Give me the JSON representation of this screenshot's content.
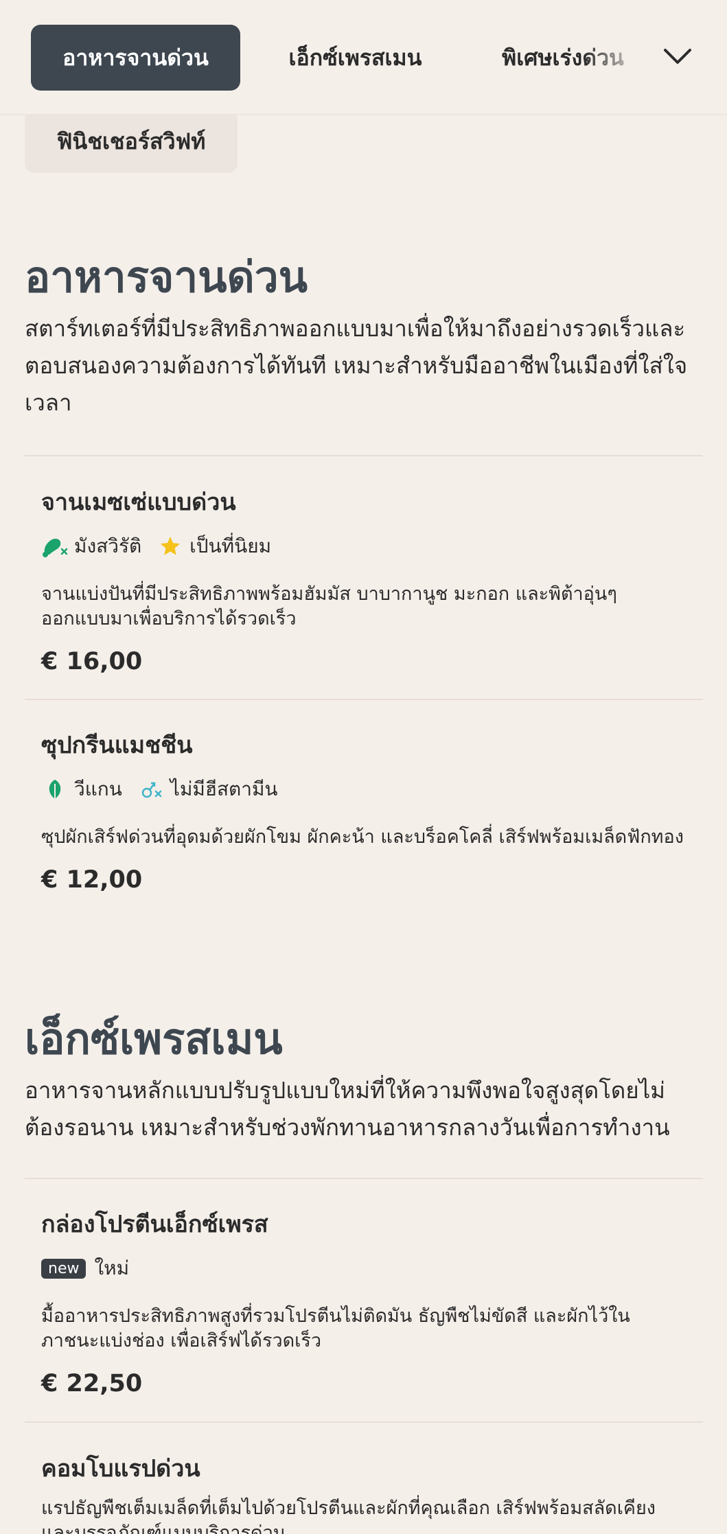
{
  "tabs": [
    {
      "label": "อาหารจานด่วน",
      "active": true
    },
    {
      "label": "เอ็กซ์เพรสเมน",
      "active": false
    },
    {
      "label": "พิเศษเร่งด่วน",
      "active": false
    }
  ],
  "more_tabs_icon": "chevron-down-icon",
  "category_pill": "ฟินิชเชอร์สวิฟท์",
  "sections": [
    {
      "title": "อาหารจานด่วน",
      "description": "สตาร์ทเตอร์ที่มีประสิทธิภาพออกแบบมาเพื่อให้มาถึงอย่างรวดเร็วและตอบสนองความต้องการได้ทันที เหมาะสำหรับมืออาชีพในเมืองที่ใส่ใจเวลา",
      "items": [
        {
          "name": "จานเมซเซ่แบบด่วน",
          "tags": [
            {
              "icon": "meat-free-icon",
              "label": "มังสวิรัติ",
              "color": "#1aa36b"
            },
            {
              "icon": "star-icon",
              "label": "เป็นที่นิยม",
              "color": "#f4c21b"
            }
          ],
          "description": "จานแบ่งปันที่มีประสิทธิภาพพร้อมฮัมมัส บาบากานูช มะกอก และพิต้าอุ่นๆ ออกแบบมาเพื่อบริการได้รวดเร็ว",
          "price": "€ 16,00"
        },
        {
          "name": "ซุปกรีนแมชชีน",
          "tags": [
            {
              "icon": "leaf-icon",
              "label": "วีแกน",
              "color": "#1aa36b"
            },
            {
              "icon": "no-histamine-icon",
              "label": "ไม่มีฮีสตามีน",
              "color": "#3fb6c9"
            }
          ],
          "description": "ซุปผักเสิร์ฟด่วนที่อุดมด้วยผักโขม ผักคะน้า และบร็อคโคลี่ เสิร์ฟพร้อมเมล็ดฟักทอง",
          "price": "€ 12,00"
        }
      ]
    },
    {
      "title": "เอ็กซ์เพรสเมน",
      "description": "อาหารจานหลักแบบปรับรูปแบบใหม่ที่ให้ความพึงพอใจสูงสุดโดยไม่ต้องรอนาน เหมาะสำหรับช่วงพักทานอาหารกลางวันเพื่อการทำงาน",
      "items": [
        {
          "name": "กล่องโปรตีนเอ็กซ์เพรส",
          "badge": "new",
          "badge_label": "ใหม่",
          "description": "มื้ออาหารประสิทธิภาพสูงที่รวมโปรตีนไม่ติดมัน ธัญพืชไม่ขัดสี และผักไว้ในภาชนะแบ่งช่อง เพื่อเสิร์ฟได้รวดเร็ว",
          "price": "€ 22,50"
        },
        {
          "name": "คอมโบแรปด่วน",
          "description": "แรปธัญพืชเต็มเมล็ดที่เต็มไปด้วยโปรตีนและผักที่คุณเลือก เสิร์ฟพร้อมสลัดเคียงและบรรจุภัณฑ์แบบบริการด่วน"
        }
      ]
    }
  ]
}
